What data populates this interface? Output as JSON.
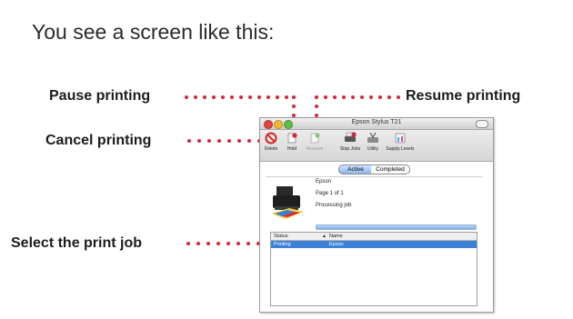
{
  "heading": "You see a screen like this:",
  "callouts": {
    "pause": "Pause printing",
    "resume": "Resume printing",
    "cancel": "Cancel printing",
    "select": "Select the print job"
  },
  "colors": {
    "dots": "#d8263a",
    "selection": "#3d80d8"
  },
  "window": {
    "title": "Epson Stylus T21",
    "toolbar": {
      "delete": "Delete",
      "hold": "Hold",
      "resume": "Resume",
      "stop_jobs": "Stop Jobs",
      "utility": "Utility",
      "supply_levels": "Supply Levels"
    },
    "tabs": {
      "active": "Active",
      "completed": "Completed"
    },
    "job": {
      "name": "Epson",
      "page": "Page 1 of 1",
      "state": "Processing job"
    },
    "table": {
      "headers": {
        "status": "Status",
        "name": "Name"
      },
      "rows": [
        {
          "status": "Printing",
          "name": "Epson"
        }
      ]
    }
  }
}
